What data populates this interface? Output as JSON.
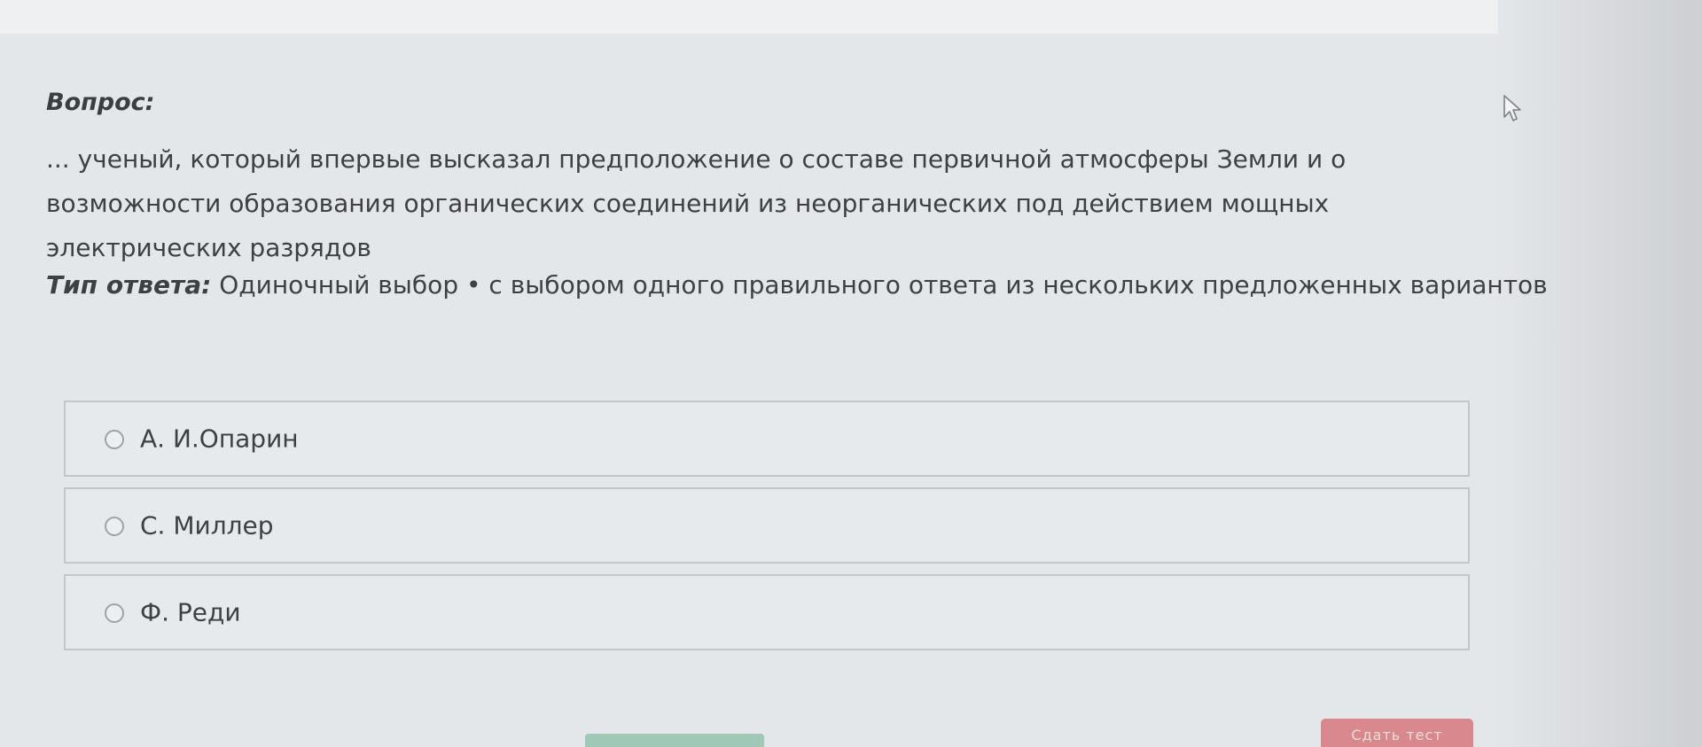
{
  "question": {
    "label": "Вопрос:",
    "text": "... ученый, который впервые высказал предположение о составе первичной атмосферы Земли и о возможности образования органических соединений из неорганических под действием мощных электрических разрядов"
  },
  "answer_type": {
    "label": "Тип ответа:",
    "value": "Одиночный выбор • с выбором одного правильного ответа из нескольких предложенных вариантов"
  },
  "options": [
    {
      "text": "А. И.Опарин"
    },
    {
      "text": "С. Миллер"
    },
    {
      "text": "Ф. Реди"
    }
  ],
  "footer": {
    "submit_label": "Сдать тест"
  },
  "icons": {
    "cursor": "mouse-pointer-icon",
    "radio": "radio-empty-icon"
  },
  "colors": {
    "background": "#e4e7ea",
    "text": "#3e4144",
    "option_border": "#c3c7c9",
    "green_button": "#9fc8b7",
    "red_button": "#d9898d"
  }
}
